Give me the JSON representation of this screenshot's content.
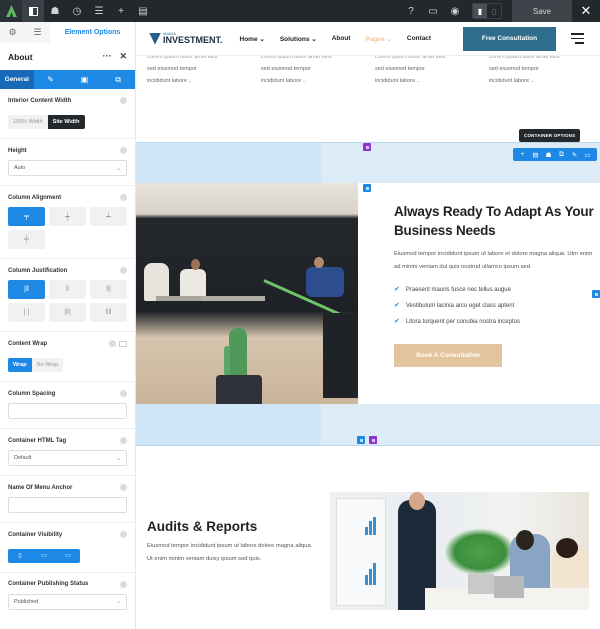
{
  "topbar": {
    "left_icons": [
      "avada-logo-icon",
      "sidebar-toggle-icon",
      "library-icon",
      "history-icon",
      "layout-icon",
      "add-icon",
      "clipboard-icon"
    ],
    "right_icons": [
      "help-icon",
      "desktop-preview-icon",
      "preview-eye-icon"
    ],
    "save_label": "Save",
    "close_label": "✕"
  },
  "sidebar": {
    "tabs": [
      {
        "icon": "gear-icon",
        "glyph": "⚙"
      },
      {
        "icon": "navigator-icon",
        "glyph": "☰"
      }
    ],
    "tab_label": "Element Options",
    "element_title": "About",
    "subtabs": [
      {
        "label": "General",
        "active": true
      },
      {
        "glyph": "✎",
        "icon": "design-icon"
      },
      {
        "glyph": "▣",
        "icon": "background-icon"
      },
      {
        "glyph": "⧉",
        "icon": "extras-icon"
      }
    ],
    "options": {
      "interior_width": {
        "label": "Interior Content Width",
        "choices": [
          "100% Width",
          "Site Width"
        ],
        "selected": "Site Width"
      },
      "height": {
        "label": "Height",
        "value": "Auto"
      },
      "column_alignment": {
        "label": "Column Alignment",
        "choices": [
          "top",
          "center",
          "bottom",
          "stretch"
        ],
        "selected": "top",
        "glyphs": [
          "╤",
          "┿",
          "┷",
          "╪"
        ]
      },
      "column_justification": {
        "label": "Column Justification",
        "choices": [
          "flex-start",
          "center",
          "flex-end",
          "space-between",
          "space-around",
          "space-evenly"
        ],
        "selected": "flex-start",
        "glyphs": [
          "|‖",
          "‖",
          "‖|",
          "| |",
          "|‖|",
          "‖‖"
        ]
      },
      "content_wrap": {
        "label": "Content Wrap",
        "choices": [
          "Wrap",
          "No Wrap"
        ],
        "selected": "Wrap"
      },
      "column_spacing": {
        "label": "Column Spacing",
        "value": ""
      },
      "html_tag": {
        "label": "Container HTML Tag",
        "value": "Default"
      },
      "menu_anchor": {
        "label": "Name Of Menu Anchor",
        "value": ""
      },
      "visibility": {
        "label": "Container Visibility",
        "devices": [
          "mobile",
          "tablet",
          "desktop"
        ],
        "glyphs": [
          "▯",
          "▭",
          "▭"
        ]
      },
      "publishing": {
        "label": "Container Publishing Status",
        "value": "Published"
      }
    }
  },
  "site": {
    "logo": {
      "small": "AVADA",
      "big": "INVESTMENT."
    },
    "menu": [
      {
        "label": "Home ⌄",
        "current": false
      },
      {
        "label": "Solutions ⌄",
        "current": false
      },
      {
        "label": "About",
        "current": false
      },
      {
        "label": "Pages ⌄",
        "current": true
      },
      {
        "label": "Contact",
        "current": false
      }
    ],
    "cta": "Free Consultation",
    "teaser_cols": [
      {
        "cut": "Lorem ipsum dolor amet elits",
        "l1": "sed eiusmod tempor",
        "l2": "incididunt labore .."
      },
      {
        "cut": "Lorem ipsum dolor amet elits",
        "l1": "sed eiusmod tempor",
        "l2": "incididunt labore .."
      },
      {
        "cut": "Lorem ipsum dolor amet elits",
        "l1": "sed eiusmod tempor",
        "l2": "incididunt labore .."
      },
      {
        "cut": "Lorem ipsum dolor amet elits",
        "l1": "sed eiusmod tempor",
        "l2": "incididunt labore .."
      }
    ],
    "container_tooltip": "CONTAINER OPTIONS",
    "container_controls": [
      "+",
      "▤",
      "☗",
      "⧉",
      "✎",
      "▭"
    ],
    "about": {
      "title": "Always Ready To Adapt As Your Business Needs",
      "text": "Eiusmod tempor incididunt ipsum ut labore et dolore magna aliqua. Utm enim ad minim veniam dui quis nostrud ullamco ipsum sed.",
      "checks": [
        "Praesent mauris fusce nec tellus augue",
        "Vestibulum lacinia arcu eget class aptent",
        "Litora torquent per conubia nostra inceptos"
      ],
      "button": "Book A Consultation"
    },
    "audits": {
      "title": "Audits & Reports",
      "text": "Eiusmod tempor incididunt ipsum ut labore dolore magna aliqua. Ut enim minim veniam duisy ipsum sed quis."
    },
    "colors": {
      "accent": "#1e88e5",
      "cta": "#2e6d8e",
      "book": "#e2c49e",
      "purple": "#8e33d6"
    }
  }
}
